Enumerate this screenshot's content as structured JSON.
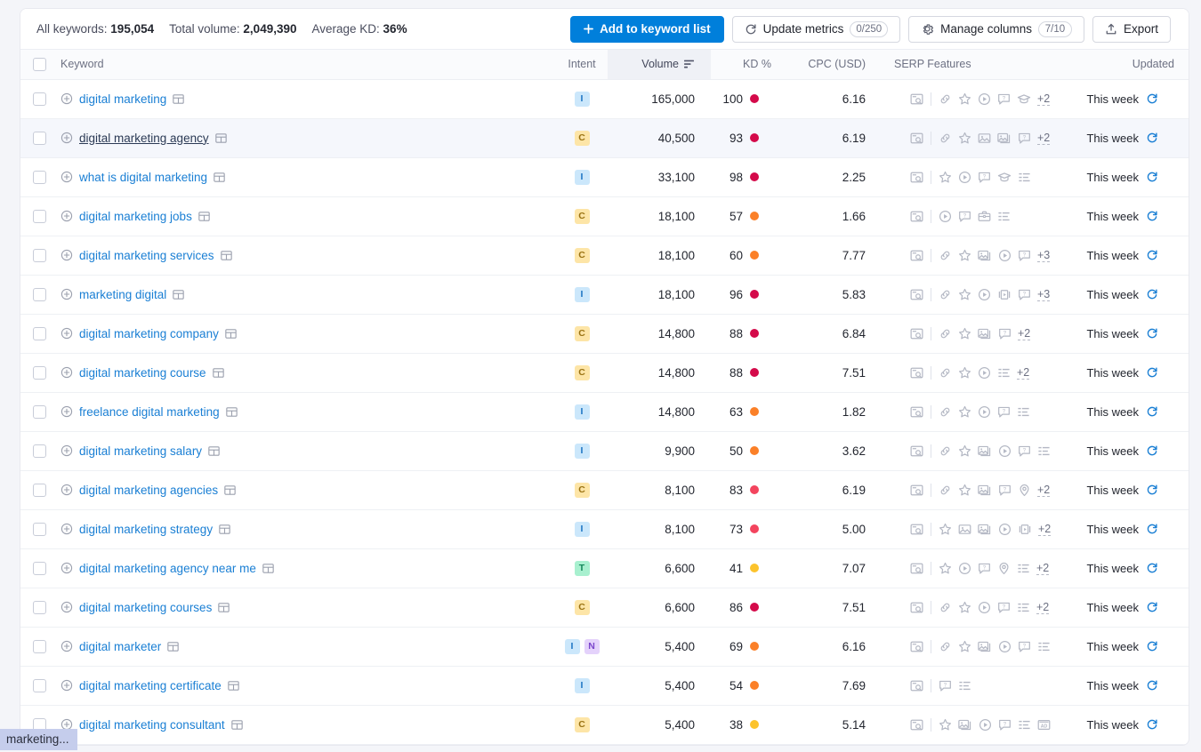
{
  "toolbar": {
    "stats": [
      {
        "label": "All keywords:",
        "value": "195,054"
      },
      {
        "label": "Total volume:",
        "value": "2,049,390"
      },
      {
        "label": "Average KD:",
        "value": "36%"
      }
    ],
    "add_to_list_label": "Add to keyword list",
    "update_metrics_label": "Update metrics",
    "update_metrics_count": "0/250",
    "manage_columns_label": "Manage columns",
    "manage_columns_count": "7/10",
    "export_label": "Export",
    "accent_color": "#007fdb"
  },
  "table": {
    "columns": {
      "keyword": "Keyword",
      "intent": "Intent",
      "volume": "Volume",
      "kd": "KD %",
      "cpc": "CPC (USD)",
      "serp": "SERP Features",
      "updated": "Updated"
    },
    "sorted_column": "volume",
    "sort_direction": "desc",
    "rows": [
      {
        "keyword": "digital marketing",
        "intents": [
          "I"
        ],
        "volume": "165,000",
        "kd": "100",
        "kd_color": "#d40a4a",
        "cpc": "6.16",
        "serp": [
          "serp-preview",
          "divider",
          "sitelinks",
          "reviews",
          "video",
          "people-also-ask",
          "knowledge-panel"
        ],
        "more": "+2",
        "updated": "This week",
        "hover": false
      },
      {
        "keyword": "digital marketing agency",
        "intents": [
          "C"
        ],
        "volume": "40,500",
        "kd": "93",
        "kd_color": "#d40a4a",
        "cpc": "6.19",
        "serp": [
          "serp-preview",
          "divider",
          "sitelinks",
          "reviews",
          "image",
          "image-pack",
          "people-also-ask"
        ],
        "more": "+2",
        "updated": "This week",
        "hover": true
      },
      {
        "keyword": "what is digital marketing",
        "intents": [
          "I"
        ],
        "volume": "33,100",
        "kd": "98",
        "kd_color": "#d40a4a",
        "cpc": "2.25",
        "serp": [
          "serp-preview",
          "divider",
          "reviews",
          "video",
          "people-also-ask",
          "knowledge-panel",
          "list"
        ],
        "more": "",
        "updated": "This week",
        "hover": false
      },
      {
        "keyword": "digital marketing jobs",
        "intents": [
          "C"
        ],
        "volume": "18,100",
        "kd": "57",
        "kd_color": "#fb8028",
        "cpc": "1.66",
        "serp": [
          "serp-preview",
          "divider",
          "video",
          "people-also-ask",
          "jobs",
          "list"
        ],
        "more": "",
        "updated": "This week",
        "hover": false
      },
      {
        "keyword": "digital marketing services",
        "intents": [
          "C"
        ],
        "volume": "18,100",
        "kd": "60",
        "kd_color": "#fb8028",
        "cpc": "7.77",
        "serp": [
          "serp-preview",
          "divider",
          "sitelinks",
          "reviews",
          "image-pack",
          "video",
          "people-also-ask"
        ],
        "more": "+3",
        "updated": "This week",
        "hover": false
      },
      {
        "keyword": "marketing digital",
        "intents": [
          "I"
        ],
        "volume": "18,100",
        "kd": "96",
        "kd_color": "#d40a4a",
        "cpc": "5.83",
        "serp": [
          "serp-preview",
          "divider",
          "sitelinks",
          "reviews",
          "video",
          "carousel",
          "people-also-ask"
        ],
        "more": "+3",
        "updated": "This week",
        "hover": false
      },
      {
        "keyword": "digital marketing company",
        "intents": [
          "C"
        ],
        "volume": "14,800",
        "kd": "88",
        "kd_color": "#d40a4a",
        "cpc": "6.84",
        "serp": [
          "serp-preview",
          "divider",
          "sitelinks",
          "reviews",
          "image-pack",
          "people-also-ask"
        ],
        "more": "+2",
        "updated": "This week",
        "hover": false
      },
      {
        "keyword": "digital marketing course",
        "intents": [
          "C"
        ],
        "volume": "14,800",
        "kd": "88",
        "kd_color": "#d40a4a",
        "cpc": "7.51",
        "serp": [
          "serp-preview",
          "divider",
          "sitelinks",
          "reviews",
          "video",
          "list"
        ],
        "more": "+2",
        "updated": "This week",
        "hover": false
      },
      {
        "keyword": "freelance digital marketing",
        "intents": [
          "I"
        ],
        "volume": "14,800",
        "kd": "63",
        "kd_color": "#fb8028",
        "cpc": "1.82",
        "serp": [
          "serp-preview",
          "divider",
          "sitelinks",
          "reviews",
          "video",
          "people-also-ask",
          "list"
        ],
        "more": "",
        "updated": "This week",
        "hover": false
      },
      {
        "keyword": "digital marketing salary",
        "intents": [
          "I"
        ],
        "volume": "9,900",
        "kd": "50",
        "kd_color": "#fb8028",
        "cpc": "3.62",
        "serp": [
          "serp-preview",
          "divider",
          "sitelinks",
          "reviews",
          "image-pack",
          "video",
          "people-also-ask",
          "list"
        ],
        "more": "",
        "updated": "This week",
        "hover": false
      },
      {
        "keyword": "digital marketing agencies",
        "intents": [
          "C"
        ],
        "volume": "8,100",
        "kd": "83",
        "kd_color": "#f3445e",
        "cpc": "6.19",
        "serp": [
          "serp-preview",
          "divider",
          "sitelinks",
          "reviews",
          "image-pack",
          "people-also-ask",
          "local-pack"
        ],
        "more": "+2",
        "updated": "This week",
        "hover": false
      },
      {
        "keyword": "digital marketing strategy",
        "intents": [
          "I"
        ],
        "volume": "8,100",
        "kd": "73",
        "kd_color": "#f3445e",
        "cpc": "5.00",
        "serp": [
          "serp-preview",
          "divider",
          "reviews",
          "image",
          "image-pack",
          "video",
          "carousel"
        ],
        "more": "+2",
        "updated": "This week",
        "hover": false
      },
      {
        "keyword": "digital marketing agency near me",
        "intents": [
          "T"
        ],
        "volume": "6,600",
        "kd": "41",
        "kd_color": "#fcc32c",
        "cpc": "7.07",
        "serp": [
          "serp-preview",
          "divider",
          "reviews",
          "video",
          "people-also-ask",
          "local-pack",
          "list"
        ],
        "more": "+2",
        "updated": "This week",
        "hover": false
      },
      {
        "keyword": "digital marketing courses",
        "intents": [
          "C"
        ],
        "volume": "6,600",
        "kd": "86",
        "kd_color": "#d40a4a",
        "cpc": "7.51",
        "serp": [
          "serp-preview",
          "divider",
          "sitelinks",
          "reviews",
          "video",
          "people-also-ask",
          "list"
        ],
        "more": "+2",
        "updated": "This week",
        "hover": false
      },
      {
        "keyword": "digital marketer",
        "intents": [
          "I",
          "N"
        ],
        "volume": "5,400",
        "kd": "69",
        "kd_color": "#fb8028",
        "cpc": "6.16",
        "serp": [
          "serp-preview",
          "divider",
          "sitelinks",
          "reviews",
          "image-pack",
          "video",
          "people-also-ask",
          "list"
        ],
        "more": "",
        "updated": "This week",
        "hover": false
      },
      {
        "keyword": "digital marketing certificate",
        "intents": [
          "I"
        ],
        "volume": "5,400",
        "kd": "54",
        "kd_color": "#fb8028",
        "cpc": "7.69",
        "serp": [
          "serp-preview",
          "divider",
          "people-also-ask",
          "list"
        ],
        "more": "",
        "updated": "This week",
        "hover": false
      },
      {
        "keyword": "digital marketing consultant",
        "intents": [
          "C"
        ],
        "volume": "5,400",
        "kd": "38",
        "kd_color": "#fcc32c",
        "cpc": "5.14",
        "serp": [
          "serp-preview",
          "divider",
          "reviews",
          "image-pack",
          "video",
          "people-also-ask",
          "list",
          "ads"
        ],
        "more": "",
        "updated": "This week",
        "hover": false
      }
    ]
  },
  "tooltip": {
    "text": "marketing..."
  }
}
